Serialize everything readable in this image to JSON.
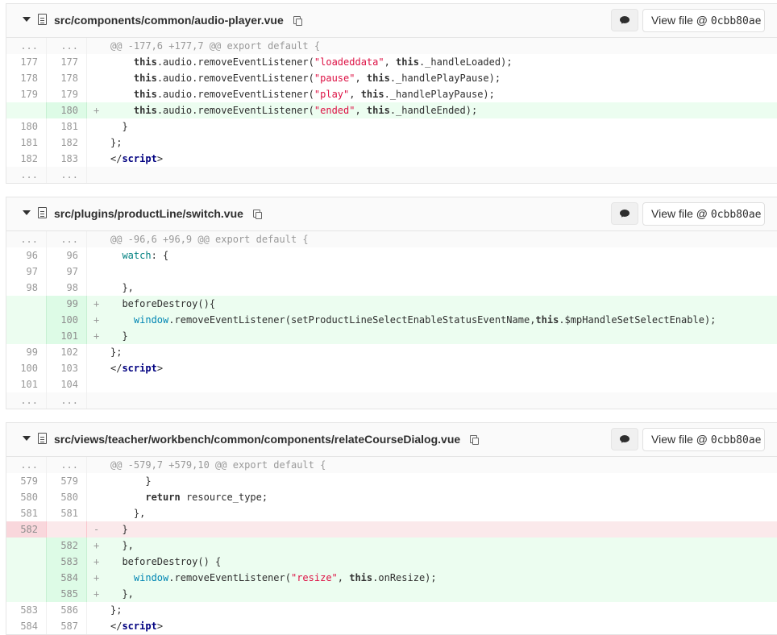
{
  "files": [
    {
      "path": "src/components/common/audio-player.vue",
      "view_file_label": "View file @ ",
      "commit": "0cbb80ae",
      "lines": [
        {
          "type": "match",
          "old": "...",
          "new": "...",
          "sign": "",
          "tokens": [
            {
              "t": "@@ -177,6 +177,7 @@ export default {",
              "c": ""
            }
          ]
        },
        {
          "type": "ctx",
          "old": "177",
          "new": "177",
          "sign": "",
          "tokens": [
            {
              "t": "    ",
              "c": ""
            },
            {
              "t": "this",
              "c": "kw"
            },
            {
              "t": ".audio.removeEventListener(",
              "c": ""
            },
            {
              "t": "\"loadeddata\"",
              "c": "str"
            },
            {
              "t": ", ",
              "c": ""
            },
            {
              "t": "this",
              "c": "kw"
            },
            {
              "t": "._handleLoaded);",
              "c": ""
            }
          ]
        },
        {
          "type": "ctx",
          "old": "178",
          "new": "178",
          "sign": "",
          "tokens": [
            {
              "t": "    ",
              "c": ""
            },
            {
              "t": "this",
              "c": "kw"
            },
            {
              "t": ".audio.removeEventListener(",
              "c": ""
            },
            {
              "t": "\"pause\"",
              "c": "str"
            },
            {
              "t": ", ",
              "c": ""
            },
            {
              "t": "this",
              "c": "kw"
            },
            {
              "t": "._handlePlayPause);",
              "c": ""
            }
          ]
        },
        {
          "type": "ctx",
          "old": "179",
          "new": "179",
          "sign": "",
          "tokens": [
            {
              "t": "    ",
              "c": ""
            },
            {
              "t": "this",
              "c": "kw"
            },
            {
              "t": ".audio.removeEventListener(",
              "c": ""
            },
            {
              "t": "\"play\"",
              "c": "str"
            },
            {
              "t": ", ",
              "c": ""
            },
            {
              "t": "this",
              "c": "kw"
            },
            {
              "t": "._handlePlayPause);",
              "c": ""
            }
          ]
        },
        {
          "type": "add",
          "old": "",
          "new": "180",
          "sign": "+",
          "tokens": [
            {
              "t": "    ",
              "c": ""
            },
            {
              "t": "this",
              "c": "kw"
            },
            {
              "t": ".audio.removeEventListener(",
              "c": ""
            },
            {
              "t": "\"ended\"",
              "c": "str"
            },
            {
              "t": ", ",
              "c": ""
            },
            {
              "t": "this",
              "c": "kw"
            },
            {
              "t": "._handleEnded);",
              "c": ""
            }
          ]
        },
        {
          "type": "ctx",
          "old": "180",
          "new": "181",
          "sign": "",
          "tokens": [
            {
              "t": "  }",
              "c": ""
            }
          ]
        },
        {
          "type": "ctx",
          "old": "181",
          "new": "182",
          "sign": "",
          "tokens": [
            {
              "t": "};",
              "c": ""
            }
          ]
        },
        {
          "type": "ctx",
          "old": "182",
          "new": "183",
          "sign": "",
          "tokens": [
            {
              "t": "</",
              "c": ""
            },
            {
              "t": "script",
              "c": "tag"
            },
            {
              "t": ">",
              "c": ""
            }
          ]
        },
        {
          "type": "match",
          "old": "...",
          "new": "...",
          "sign": "",
          "tokens": []
        }
      ]
    },
    {
      "path": "src/plugins/productLine/switch.vue",
      "view_file_label": "View file @ ",
      "commit": "0cbb80ae",
      "lines": [
        {
          "type": "match",
          "old": "...",
          "new": "...",
          "sign": "",
          "tokens": [
            {
              "t": "@@ -96,6 +96,9 @@ export default {",
              "c": ""
            }
          ]
        },
        {
          "type": "ctx",
          "old": "96",
          "new": "96",
          "sign": "",
          "tokens": [
            {
              "t": "  ",
              "c": ""
            },
            {
              "t": "watch",
              "c": "prop"
            },
            {
              "t": ": {",
              "c": ""
            }
          ]
        },
        {
          "type": "ctx",
          "old": "97",
          "new": "97",
          "sign": "",
          "tokens": []
        },
        {
          "type": "ctx",
          "old": "98",
          "new": "98",
          "sign": "",
          "tokens": [
            {
              "t": "  },",
              "c": ""
            }
          ]
        },
        {
          "type": "add",
          "old": "",
          "new": "99",
          "sign": "+",
          "tokens": [
            {
              "t": "  beforeDestroy(){",
              "c": ""
            }
          ]
        },
        {
          "type": "add",
          "old": "",
          "new": "100",
          "sign": "+",
          "tokens": [
            {
              "t": "    ",
              "c": ""
            },
            {
              "t": "window",
              "c": "glob"
            },
            {
              "t": ".removeEventListener(setProductLineSelectEnableStatusEventName,",
              "c": ""
            },
            {
              "t": "this",
              "c": "kw"
            },
            {
              "t": ".$mpHandleSetSelectEnable);",
              "c": ""
            }
          ]
        },
        {
          "type": "add",
          "old": "",
          "new": "101",
          "sign": "+",
          "tokens": [
            {
              "t": "  }",
              "c": ""
            }
          ]
        },
        {
          "type": "ctx",
          "old": "99",
          "new": "102",
          "sign": "",
          "tokens": [
            {
              "t": "};",
              "c": ""
            }
          ]
        },
        {
          "type": "ctx",
          "old": "100",
          "new": "103",
          "sign": "",
          "tokens": [
            {
              "t": "</",
              "c": ""
            },
            {
              "t": "script",
              "c": "tag"
            },
            {
              "t": ">",
              "c": ""
            }
          ]
        },
        {
          "type": "ctx",
          "old": "101",
          "new": "104",
          "sign": "",
          "tokens": []
        },
        {
          "type": "match",
          "old": "...",
          "new": "...",
          "sign": "",
          "tokens": []
        }
      ]
    },
    {
      "path": "src/views/teacher/workbench/common/components/relateCourseDialog.vue",
      "view_file_label": "View file @ ",
      "commit": "0cbb80ae",
      "lines": [
        {
          "type": "match",
          "old": "...",
          "new": "...",
          "sign": "",
          "tokens": [
            {
              "t": "@@ -579,7 +579,10 @@ export default {",
              "c": ""
            }
          ]
        },
        {
          "type": "ctx",
          "old": "579",
          "new": "579",
          "sign": "",
          "tokens": [
            {
              "t": "      }",
              "c": ""
            }
          ]
        },
        {
          "type": "ctx",
          "old": "580",
          "new": "580",
          "sign": "",
          "tokens": [
            {
              "t": "      ",
              "c": ""
            },
            {
              "t": "return",
              "c": "kw"
            },
            {
              "t": " resource_type;",
              "c": ""
            }
          ]
        },
        {
          "type": "ctx",
          "old": "581",
          "new": "581",
          "sign": "",
          "tokens": [
            {
              "t": "    },",
              "c": ""
            }
          ]
        },
        {
          "type": "del",
          "old": "582",
          "new": "",
          "sign": "-",
          "tokens": [
            {
              "t": "  }",
              "c": ""
            }
          ]
        },
        {
          "type": "add",
          "old": "",
          "new": "582",
          "sign": "+",
          "tokens": [
            {
              "t": "  },",
              "c": ""
            }
          ]
        },
        {
          "type": "add",
          "old": "",
          "new": "583",
          "sign": "+",
          "tokens": [
            {
              "t": "  beforeDestroy() {",
              "c": ""
            }
          ]
        },
        {
          "type": "add",
          "old": "",
          "new": "584",
          "sign": "+",
          "tokens": [
            {
              "t": "    ",
              "c": ""
            },
            {
              "t": "window",
              "c": "glob"
            },
            {
              "t": ".removeEventListener(",
              "c": ""
            },
            {
              "t": "\"resize\"",
              "c": "str"
            },
            {
              "t": ", ",
              "c": ""
            },
            {
              "t": "this",
              "c": "kw"
            },
            {
              "t": ".onResize);",
              "c": ""
            }
          ]
        },
        {
          "type": "add",
          "old": "",
          "new": "585",
          "sign": "+",
          "tokens": [
            {
              "t": "  },",
              "c": ""
            }
          ]
        },
        {
          "type": "ctx",
          "old": "583",
          "new": "586",
          "sign": "",
          "tokens": [
            {
              "t": "};",
              "c": ""
            }
          ]
        },
        {
          "type": "ctx",
          "old": "584",
          "new": "587",
          "sign": "",
          "tokens": [
            {
              "t": "</",
              "c": ""
            },
            {
              "t": "script",
              "c": "tag"
            },
            {
              "t": ">",
              "c": ""
            }
          ]
        }
      ]
    }
  ]
}
